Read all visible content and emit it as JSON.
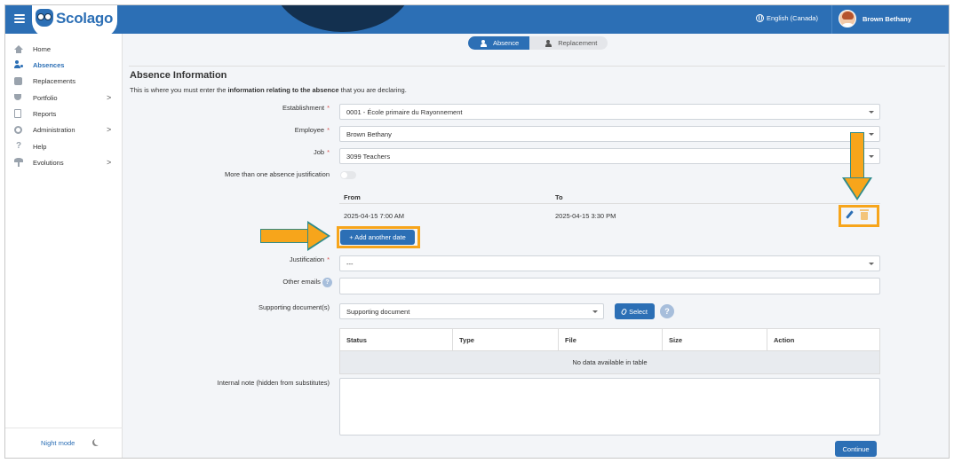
{
  "header": {
    "brand": "Scolago",
    "language": "English (Canada)",
    "user_name": "Brown Bethany"
  },
  "sidebar": {
    "items": [
      {
        "label": "Home",
        "icon": "home-icon"
      },
      {
        "label": "Absences",
        "icon": "user-absence-icon",
        "active": true
      },
      {
        "label": "Replacements",
        "icon": "replacement-icon"
      },
      {
        "label": "Portfolio",
        "icon": "trophy-icon",
        "chevron": ">"
      },
      {
        "label": "Reports",
        "icon": "document-icon"
      },
      {
        "label": "Administration",
        "icon": "gear-icon",
        "chevron": ">"
      },
      {
        "label": "Help",
        "icon": "question-icon"
      },
      {
        "label": "Evolutions",
        "icon": "sprout-icon",
        "chevron": ">"
      }
    ],
    "night_mode": "Night mode"
  },
  "stepper": {
    "absence": "Absence",
    "replacement": "Replacement"
  },
  "form": {
    "title": "Absence Information",
    "desc_before": "This is where you must enter the ",
    "desc_bold": "information relating to the absence",
    "desc_after": " that you are declaring.",
    "required_mark": "*",
    "establishment_label": "Establishment",
    "establishment_value": "0001 - École primaire du Rayonnement",
    "employee_label": "Employee",
    "employee_value": "Brown Bethany",
    "job_label": "Job",
    "job_value": "3099 Teachers",
    "multi_justification_label": "More than one absence justification",
    "dates": {
      "from_header": "From",
      "to_header": "To",
      "rows": [
        {
          "from": "2025-04-15 7:00 AM",
          "to": "2025-04-15 3:30 PM"
        }
      ]
    },
    "add_date_button": "+ Add another date",
    "justification_label": "Justification",
    "justification_value": "---",
    "other_emails_label": "Other emails",
    "help_mark": "?",
    "supporting_docs_label": "Supporting document(s)",
    "supporting_doc_value": "Supporting document",
    "select_button": "Select",
    "docs_table": {
      "headers": [
        "Status",
        "Type",
        "File",
        "Size",
        "Action"
      ],
      "empty_text": "No data available in table"
    },
    "internal_note_label": "Internal note (hidden from substitutes)",
    "continue_button": "Continue"
  },
  "colors": {
    "primary": "#2c6fb5",
    "highlight": "#f7a51b",
    "arrow_outline": "#2e8b8b",
    "required": "#d9534f"
  }
}
